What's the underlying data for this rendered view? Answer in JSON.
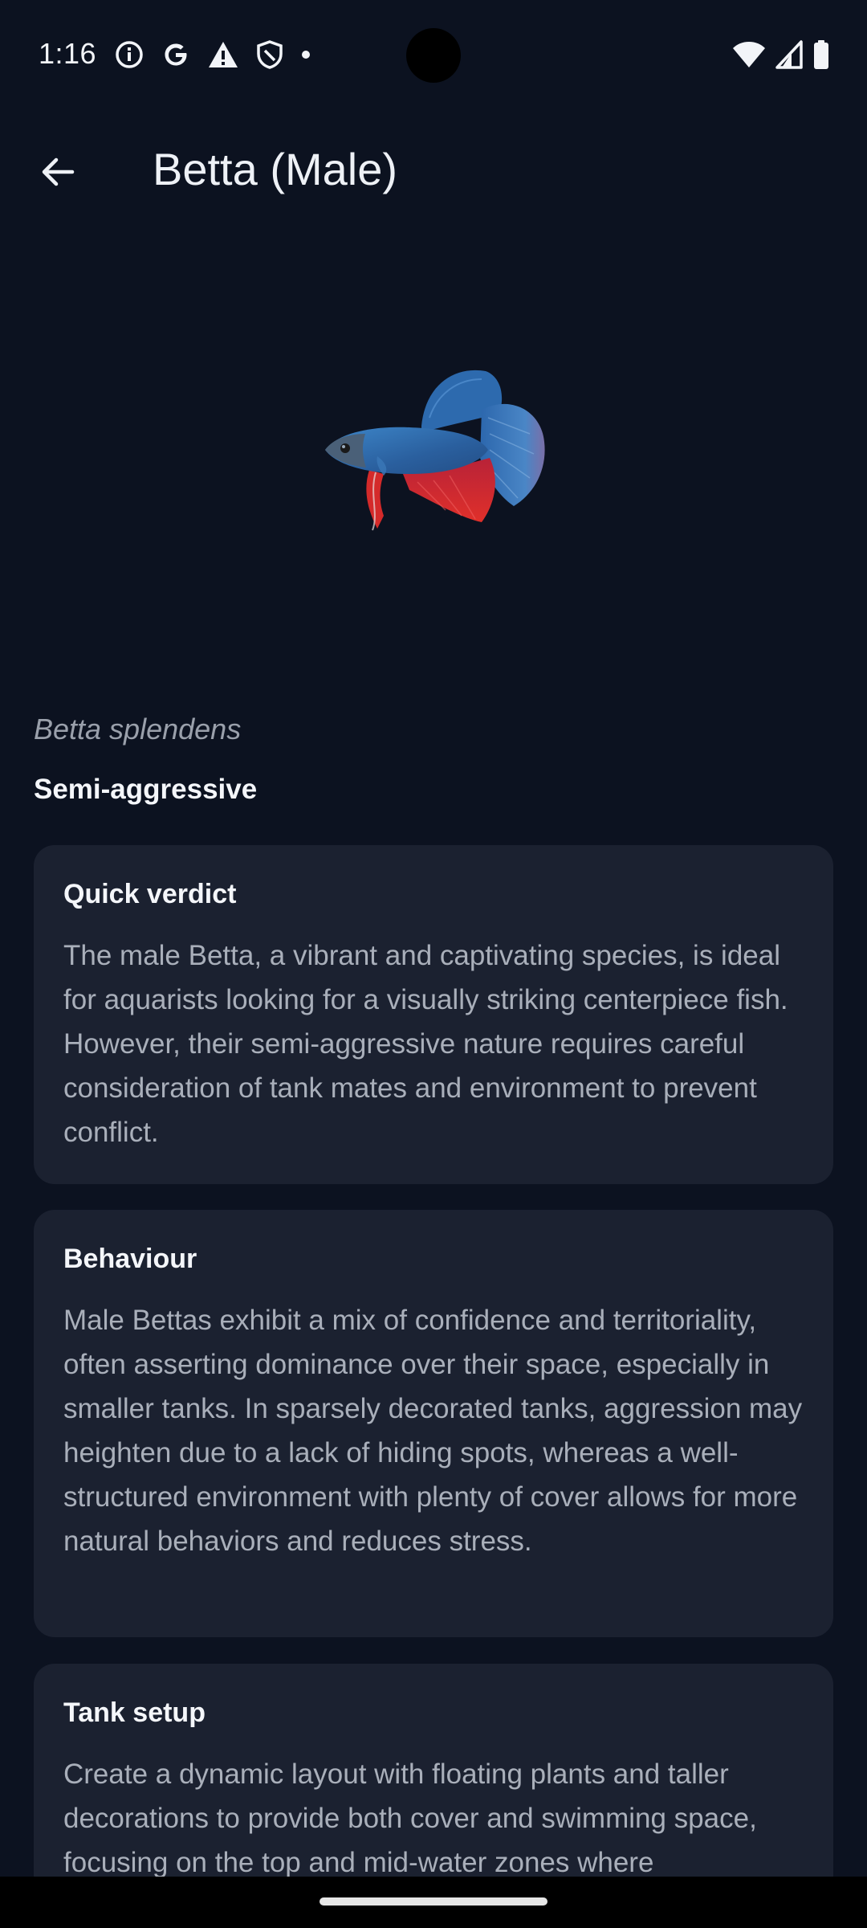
{
  "status_bar": {
    "time": "1:16",
    "left_icons": [
      "info-icon",
      "google-icon",
      "warning-icon",
      "shield-icon",
      "dot-icon"
    ],
    "right_icons": [
      "wifi-icon",
      "signal-icon",
      "battery-icon"
    ]
  },
  "app_bar": {
    "title": "Betta (Male)",
    "back_icon": "arrow-back-icon"
  },
  "species": {
    "scientific_name": "Betta splendens",
    "temperament": "Semi-aggressive"
  },
  "sections": [
    {
      "title": "Quick verdict",
      "body": "The male Betta, a vibrant and captivating species, is ideal for aquarists looking for a visually striking centerpiece fish. However, their semi-aggressive nature requires careful consideration of tank mates and environment to prevent conflict."
    },
    {
      "title": "Behaviour",
      "body": "Male Bettas exhibit a mix of confidence and territoriality, often asserting dominance over their space, especially in smaller tanks. In sparsely decorated tanks, aggression may heighten due to a lack of hiding spots, whereas a well-structured environment with plenty of cover allows for more natural behaviors and reduces stress."
    },
    {
      "title": "Tank setup",
      "body": "Create a dynamic layout with floating plants and taller decorations to provide both cover and swimming space, focusing on the top and mid-water zones where"
    }
  ],
  "colors": {
    "background": "#0c1220",
    "card": "#1b2130",
    "text_primary": "#f4f6fa",
    "text_secondary": "#a9afba",
    "fish_blue": "#2f6fb8",
    "fish_red": "#d42a2a"
  }
}
